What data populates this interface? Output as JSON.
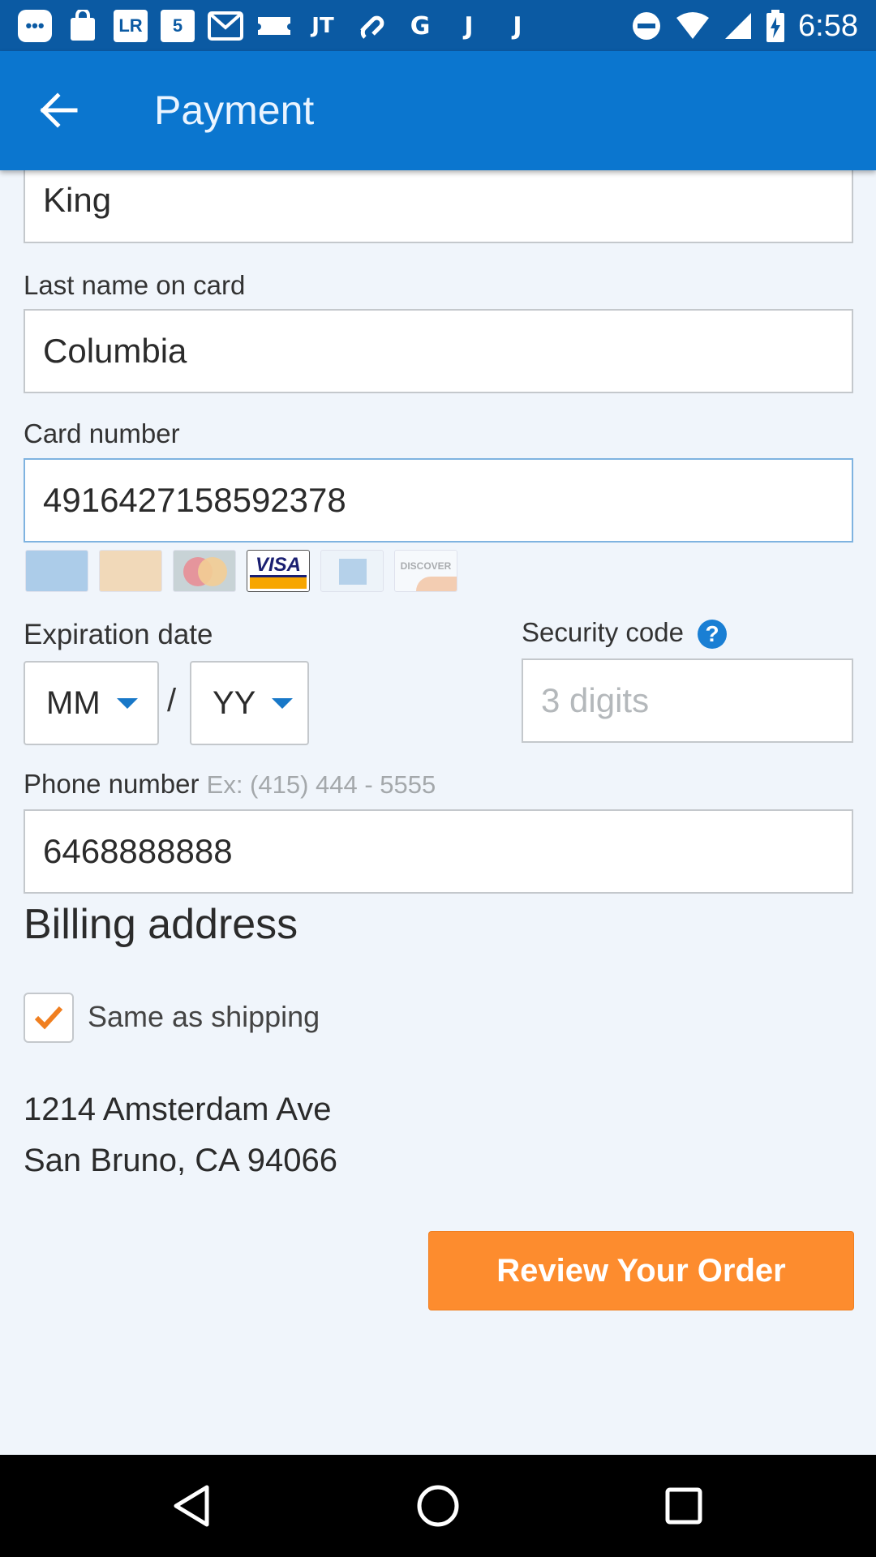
{
  "status_bar": {
    "time": "6:58",
    "notification_icons": [
      "chat-icon",
      "shopping-bag-icon",
      "lr-icon",
      "five-icon",
      "mail-icon",
      "ticket-icon",
      "jt-icon",
      "link-icon",
      "g-icon",
      "j-icon",
      "j-icon"
    ],
    "notification_glyphs": [
      "",
      "",
      "LR",
      "5",
      "M",
      "",
      "JT",
      "",
      "G",
      "J",
      "J"
    ],
    "system_icons": [
      "do-not-disturb-icon",
      "wifi-icon",
      "signal-icon",
      "battery-charging-icon"
    ]
  },
  "app_bar": {
    "title": "Payment",
    "background": "#0b76cf"
  },
  "form": {
    "first_name_value": "King",
    "last_name_label": "Last name on card",
    "last_name_value": "Columbia",
    "card_number_label": "Card number",
    "card_number_value": "4916427158592378",
    "card_logos": [
      "card-generic-blue",
      "card-generic-gold",
      "mastercard",
      "visa",
      "amex",
      "discover"
    ],
    "active_card": "visa",
    "visa_text": "VISA",
    "discover_text": "DISCOVER",
    "expiration_label": "Expiration date",
    "month_value": "MM",
    "year_value": "YY",
    "separator": "/",
    "security_label": "Security code",
    "security_help": "?",
    "security_placeholder": "3 digits",
    "phone_label": "Phone number",
    "phone_hint": "Ex: (415) 444 - 5555",
    "phone_value": "6468888888"
  },
  "billing": {
    "title": "Billing address",
    "same_as_shipping_label": "Same as shipping",
    "same_as_shipping_checked": true,
    "address_line1": "1214 Amsterdam Ave",
    "address_line2": "San Bruno, CA 94066"
  },
  "actions": {
    "review_label": "Review Your Order",
    "accent": "#fd8c2e"
  }
}
